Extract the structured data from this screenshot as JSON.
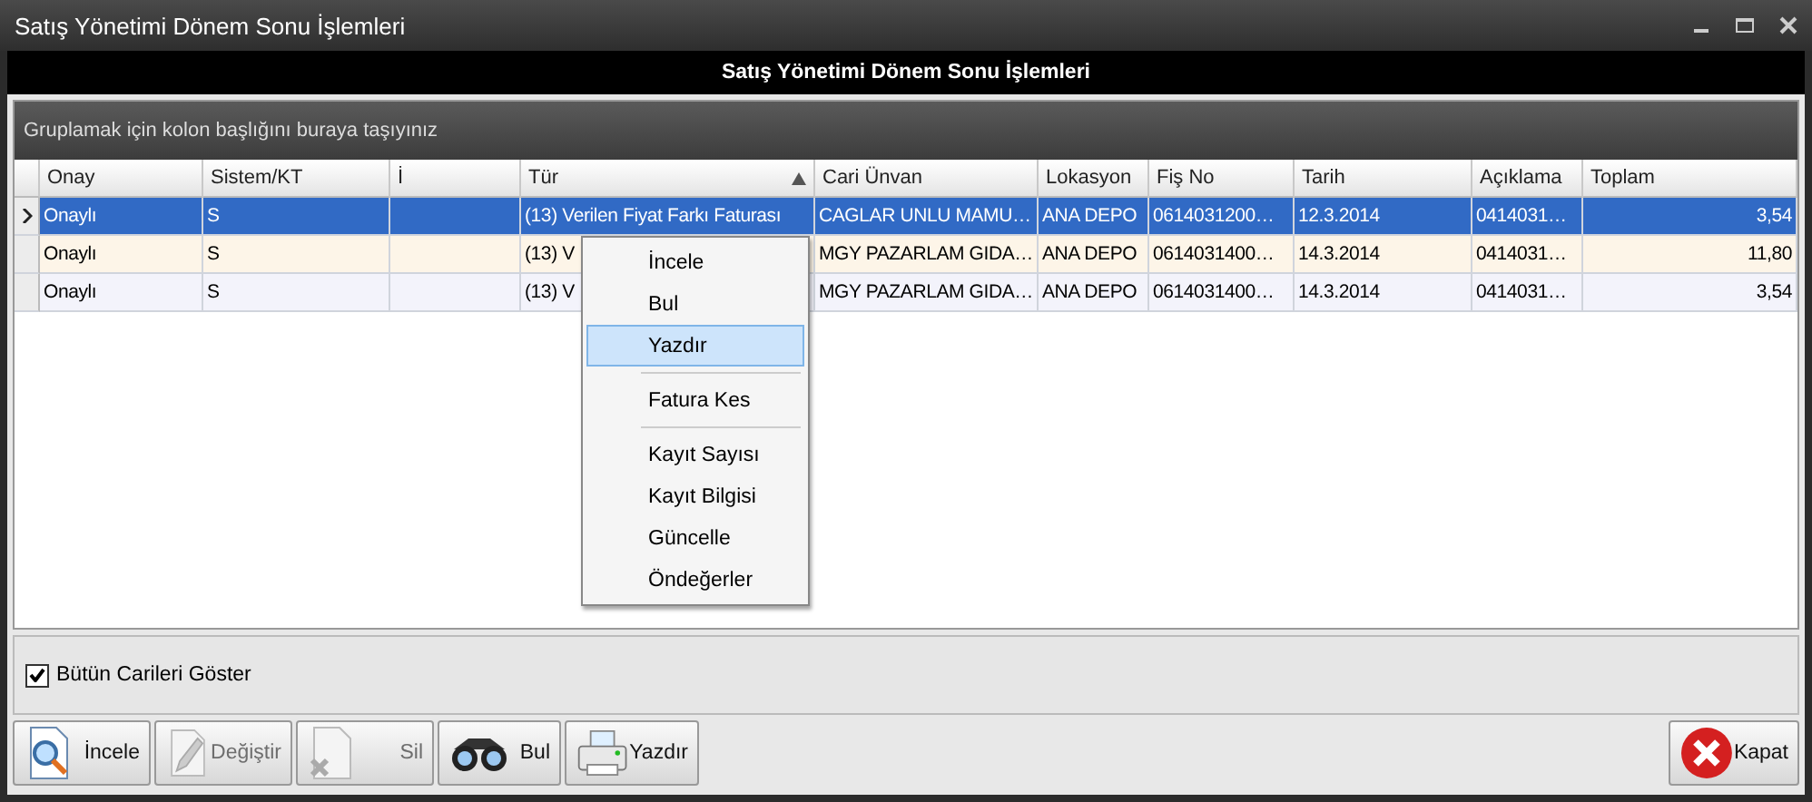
{
  "window": {
    "title": "Satış Yönetimi Dönem Sonu İşlemleri"
  },
  "header": {
    "title": "Satış Yönetimi Dönem Sonu İşlemleri"
  },
  "group_panel": {
    "hint": "Gruplamak için kolon başlığını buraya taşıyınız"
  },
  "table": {
    "columns": [
      {
        "label": "Onay",
        "kind": "text"
      },
      {
        "label": "Sistem/KT",
        "kind": "text"
      },
      {
        "label": "İ",
        "kind": "text"
      },
      {
        "label": "Tür",
        "kind": "text",
        "sorted": true
      },
      {
        "label": "Cari Ünvan",
        "kind": "text"
      },
      {
        "label": "Lokasyon",
        "kind": "text"
      },
      {
        "label": "Fiş No",
        "kind": "text"
      },
      {
        "label": "Tarih",
        "kind": "text"
      },
      {
        "label": "Açıklama",
        "kind": "text"
      },
      {
        "label": "Toplam",
        "kind": "number"
      }
    ],
    "rows": [
      {
        "selected": true,
        "cells": [
          "Onaylı",
          "S",
          "",
          "(13) Verilen Fiyat Farkı Faturası",
          "CAGLAR UNLU MAMU…",
          "ANA DEPO",
          "0614031200…",
          "12.3.2014",
          "0414031…",
          "3,54"
        ]
      },
      {
        "selected": false,
        "cells": [
          "Onaylı",
          "S",
          "",
          "(13) V",
          "MGY PAZARLAM GIDA…",
          "ANA DEPO",
          "0614031400…",
          "14.3.2014",
          "0414031…",
          "11,80"
        ]
      },
      {
        "selected": false,
        "cells": [
          "Onaylı",
          "S",
          "",
          "(13) V",
          "MGY PAZARLAM GIDA…",
          "ANA DEPO",
          "0614031400…",
          "14.3.2014",
          "0414031…",
          "3,54"
        ]
      }
    ]
  },
  "context_menu": [
    {
      "kind": "item",
      "label": "İncele",
      "selected": false
    },
    {
      "kind": "item",
      "label": "Bul",
      "selected": false
    },
    {
      "kind": "item",
      "label": "Yazdır",
      "selected": true
    },
    {
      "kind": "separator"
    },
    {
      "kind": "item",
      "label": "Fatura Kes",
      "selected": false
    },
    {
      "kind": "separator"
    },
    {
      "kind": "item",
      "label": "Kayıt Sayısı",
      "selected": false
    },
    {
      "kind": "item",
      "label": "Kayıt Bilgisi",
      "selected": false
    },
    {
      "kind": "item",
      "label": "Güncelle",
      "selected": false
    },
    {
      "kind": "item",
      "label": "Öndeğerler",
      "selected": false
    }
  ],
  "checkbox": {
    "label": "Bütün Carileri Göster",
    "checked": true
  },
  "buttons": [
    {
      "kind": "inspect",
      "label": "İncele",
      "disabled": false
    },
    {
      "kind": "edit",
      "label": "Değiştir",
      "disabled": true
    },
    {
      "kind": "delete",
      "label": "Sil",
      "disabled": true
    },
    {
      "kind": "find",
      "label": "Bul",
      "disabled": false
    },
    {
      "kind": "print",
      "label": "Yazdır",
      "disabled": false
    }
  ],
  "close_button": {
    "label": "Kapat"
  }
}
